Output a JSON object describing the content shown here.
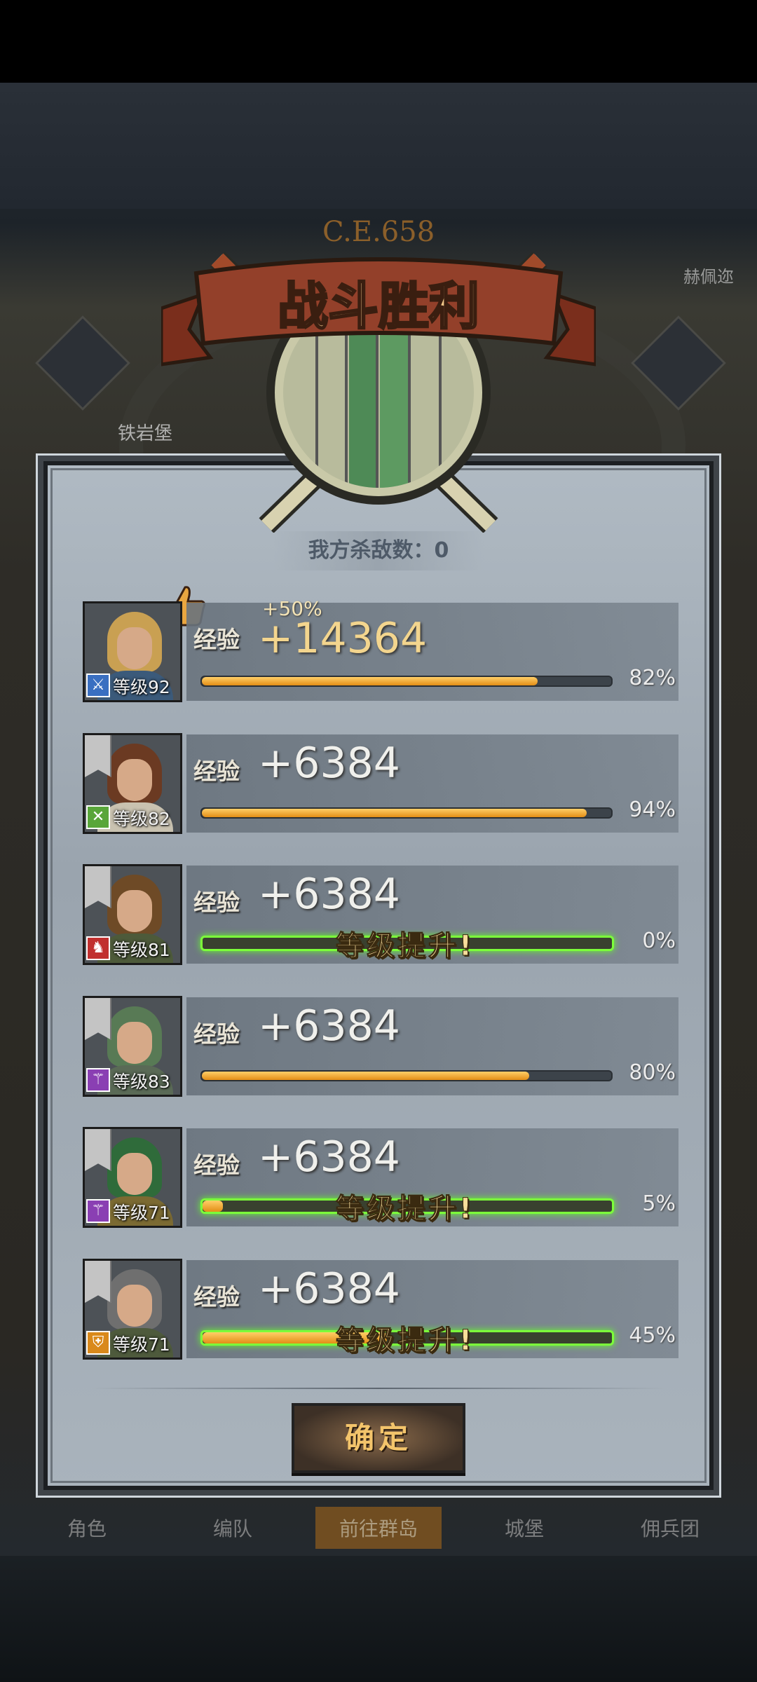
{
  "background": {
    "year": "C.E.658",
    "map_label_left": "铁岩堡",
    "map_label_right": "赫佩迩",
    "tabs": [
      "角色",
      "编队",
      "前往群岛",
      "城堡",
      "佣兵团"
    ],
    "active_tab": "前往群岛"
  },
  "dialog": {
    "title": "战斗胜利",
    "kills_text": "我方杀敌数：0",
    "confirm_label": "确定",
    "exp_label": "经验",
    "level_up_text": "等级提升!",
    "heroes": [
      {
        "level_text": "等级92",
        "class_icon": "sword-icon",
        "class_color": "#3a6fc1",
        "bonus": "+50%",
        "exp_gain": "+14364",
        "percent_text": "82%",
        "progress": 0.82,
        "level_up": false
      },
      {
        "level_text": "等级82",
        "class_icon": "crossed-swords-icon",
        "class_color": "#59a63a",
        "exp_gain": "+6384",
        "percent_text": "94%",
        "progress": 0.94,
        "level_up": false
      },
      {
        "level_text": "等级81",
        "class_icon": "horse-icon",
        "class_color": "#c1302f",
        "exp_gain": "+6384",
        "percent_text": "0%",
        "progress": 0.0,
        "level_up": true
      },
      {
        "level_text": "等级83",
        "class_icon": "staff-icon",
        "class_color": "#8a3fb3",
        "exp_gain": "+6384",
        "percent_text": "80%",
        "progress": 0.8,
        "level_up": false
      },
      {
        "level_text": "等级71",
        "class_icon": "staff-icon",
        "class_color": "#8a3fb3",
        "exp_gain": "+6384",
        "percent_text": "5%",
        "progress": 0.05,
        "level_up": true
      },
      {
        "level_text": "等级71",
        "class_icon": "shield-icon",
        "class_color": "#d9891b",
        "exp_gain": "+6384",
        "percent_text": "45%",
        "progress": 0.45,
        "level_up": true
      }
    ]
  },
  "colors": {
    "exp_fill": "#e8961c",
    "level_up_glow": "#7cff3a",
    "title_text": "#f2c88a",
    "ribbon": "#8e3a22"
  }
}
